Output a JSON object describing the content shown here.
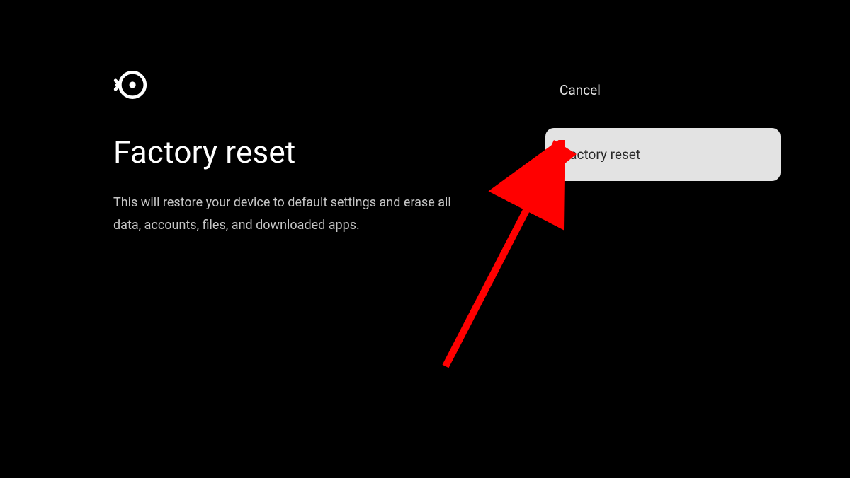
{
  "content": {
    "icon_name": "restore-icon",
    "title": "Factory reset",
    "description": "This will restore your device to default settings and erase all data, accounts, files, and downloaded apps."
  },
  "actions": {
    "cancel_label": "Cancel",
    "confirm_label": "Factory reset"
  },
  "annotation": {
    "arrow_color": "#ff0000"
  }
}
